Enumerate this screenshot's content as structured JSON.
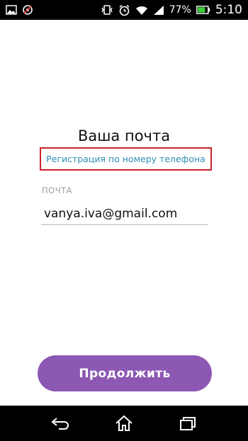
{
  "status_bar": {
    "icons_left": [
      "gallery-icon",
      "sync-disabled-icon"
    ],
    "icons_right": [
      "vibrate-icon",
      "alarm-clock-icon",
      "wifi-icon",
      "signal-icon"
    ],
    "battery_percent": "77%",
    "battery_level": 0.77,
    "time": "5:10"
  },
  "main": {
    "title": "Ваша почта",
    "phone_link": "Регистрация по номеру телефона",
    "email_label": "ПОЧТА",
    "email_value": "vanya.iva@gmail.com",
    "continue_label": "Продолжить"
  },
  "nav_bar": {
    "buttons": [
      "back-icon",
      "home-icon",
      "recent-apps-icon"
    ]
  },
  "colors": {
    "accent": "#8c58b3",
    "link": "#2f8fb4",
    "highlight_box": "#c8232c",
    "battery": "#39d039"
  }
}
